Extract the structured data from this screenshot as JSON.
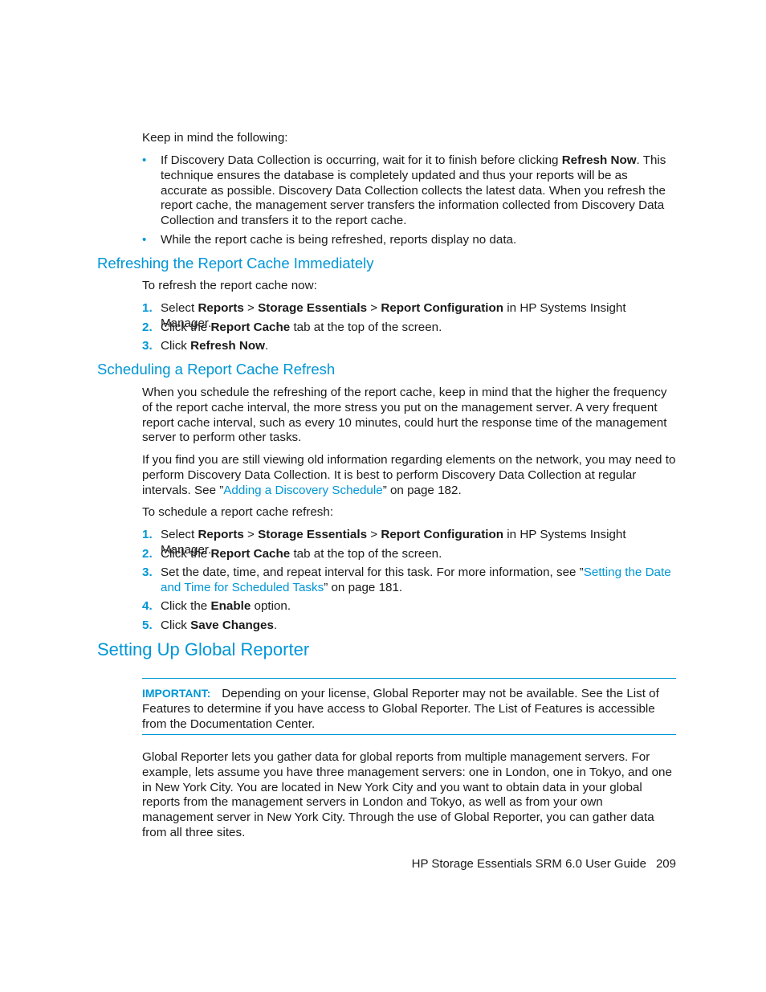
{
  "intro": {
    "lead": "Keep in mind the following:",
    "bullets": [
      {
        "before": "If Discovery Data Collection is occurring, wait for it to finish before clicking ",
        "bold": "Refresh Now",
        "after_line1": ". This",
        "rest": "technique ensures the database is completely updated and thus your reports will be as accurate as possible. Discovery Data Collection collects the latest data. When you refresh the report cache, the management server transfers the information collected from Discovery Data Collection and transfers it to the report cache."
      },
      {
        "text": "While the report cache is being refreshed, reports display no data."
      }
    ]
  },
  "section_refresh_now": {
    "heading": "Refreshing the Report Cache Immediately",
    "lead": "To refresh the report cache now:",
    "steps": [
      {
        "num": "1.",
        "t1": "Select ",
        "b1": "Reports",
        "t2": " > ",
        "b2": "Storage Essentials",
        "t3": " > ",
        "b3": "Report Configuration",
        "t4": " in HP Systems Insight Manager."
      },
      {
        "num": "2.",
        "t1": "Click the ",
        "b1": "Report Cache",
        "t2": " tab at the top of the screen."
      },
      {
        "num": "3.",
        "t1": "Click ",
        "b1": "Refresh Now",
        "t2": "."
      }
    ]
  },
  "section_schedule": {
    "heading": "Scheduling a Report Cache Refresh",
    "para1": "When you schedule the refreshing of the report cache, keep in mind that the higher the frequency of the report cache interval, the more stress you put on the management server. A very frequent report cache interval, such as every 10 minutes, could hurt the response time of the management server to perform other tasks.",
    "para2_before": "If you find you are still viewing old information regarding elements on the network, you may need to perform Discovery Data Collection. It is best to perform Discovery Data Collection at regular intervals. See ”",
    "para2_link": "Adding a Discovery Schedule",
    "para2_after": "” on page 182.",
    "lead": "To schedule a report cache refresh:",
    "steps": [
      {
        "num": "1.",
        "t1": "Select ",
        "b1": "Reports",
        "t2": " > ",
        "b2": "Storage Essentials",
        "t3": " > ",
        "b3": "Report Configuration",
        "t4": " in HP Systems Insight Manager."
      },
      {
        "num": "2.",
        "t1": "Click the ",
        "b1": "Report Cache",
        "t2": " tab at the top of the screen."
      },
      {
        "num": "3.",
        "t1": "Set the date, time, and repeat interval for this task. For more information, see ”",
        "link": "Setting the Date and Time for Scheduled Tasks",
        "t2": "” on page 181."
      },
      {
        "num": "4.",
        "t1": "Click the ",
        "b1": "Enable",
        "t2": " option."
      },
      {
        "num": "5.",
        "t1": "Click ",
        "b1": "Save Changes",
        "t2": "."
      }
    ]
  },
  "section_global": {
    "heading": "Setting Up Global Reporter",
    "important_label": "IMPORTANT:",
    "important_text": "Depending on your license, Global Reporter may not be available. See the List of Features to determine if you have access to Global Reporter. The List of Features is accessible from the Documentation Center.",
    "para": "Global Reporter lets you gather data for global reports from multiple management servers. For example, lets assume you have three management servers: one in London, one in Tokyo, and one in New York City. You are located in New York City and you want to obtain data in your global reports from the management servers in London and Tokyo, as well as from your own management server in New York City. Through the use of Global Reporter, you can gather data from all three sites."
  },
  "footer": {
    "title": "HP Storage Essentials SRM 6.0 User Guide",
    "page": "209"
  },
  "colors": {
    "accent": "#0096d6",
    "text": "#1a1a1a"
  }
}
